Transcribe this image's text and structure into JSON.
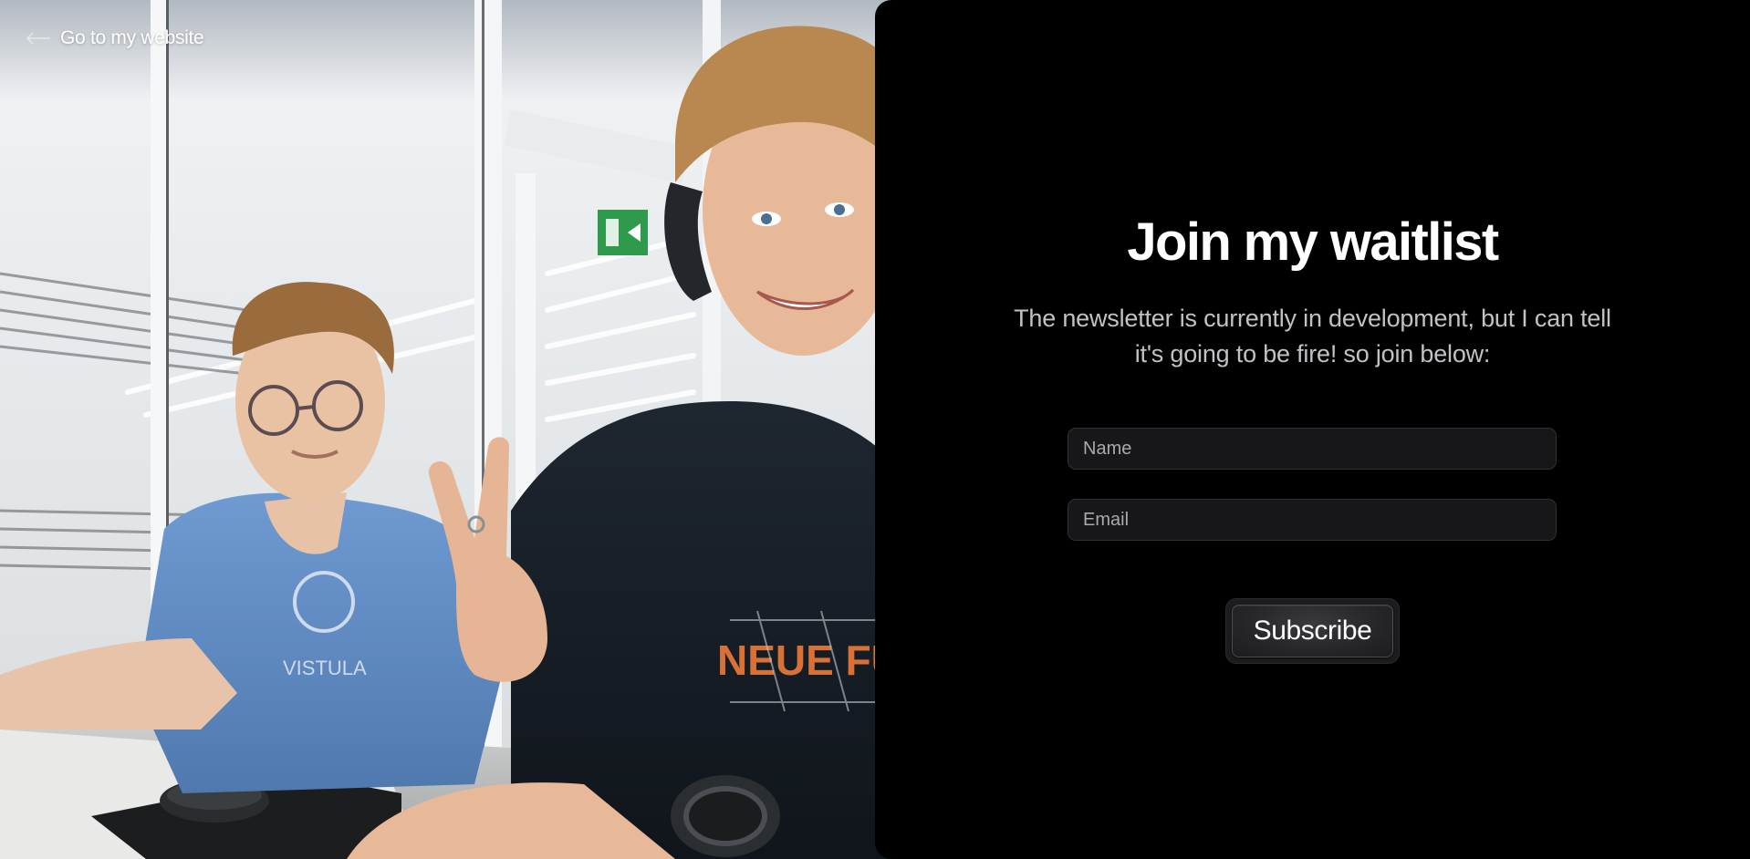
{
  "nav": {
    "back_label": "Go to my website",
    "back_icon": "arrow-left-icon"
  },
  "photo": {
    "description_icon": "photo"
  },
  "waitlist": {
    "title": "Join my waitlist",
    "subtitle": "The newsletter is currently in development, but I can tell it's going to be fire! so join below:",
    "name_placeholder": "Name",
    "name_value": "",
    "email_placeholder": "Email",
    "email_value": "",
    "subscribe_label": "Subscribe"
  },
  "colors": {
    "panel_bg": "#000000",
    "title": "#ffffff",
    "subtitle": "#c2c2c6",
    "input_bg": "#17171a",
    "input_border": "#303035",
    "button_bg": "#262629"
  }
}
